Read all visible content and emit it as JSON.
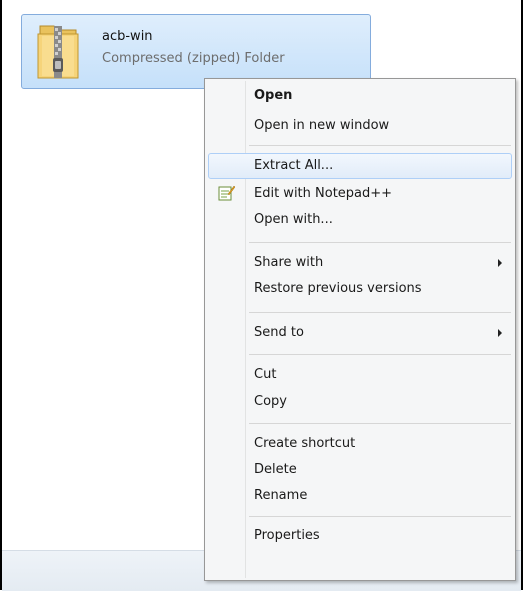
{
  "file": {
    "name": "acb-win",
    "type": "Compressed (zipped) Folder",
    "icon": "zip-folder-icon"
  },
  "menu": {
    "open": "Open",
    "open_new_window": "Open in new window",
    "extract_all": "Extract All...",
    "edit_notepad": "Edit with Notepad++",
    "open_with": "Open with...",
    "share_with": "Share with",
    "restore_versions": "Restore previous versions",
    "send_to": "Send to",
    "cut": "Cut",
    "copy": "Copy",
    "create_shortcut": "Create shortcut",
    "delete": "Delete",
    "rename": "Rename",
    "properties": "Properties"
  },
  "colors": {
    "selection_fill": "#c5e0fa",
    "selection_border": "#84acdd",
    "hover_border": "#aecff7"
  }
}
